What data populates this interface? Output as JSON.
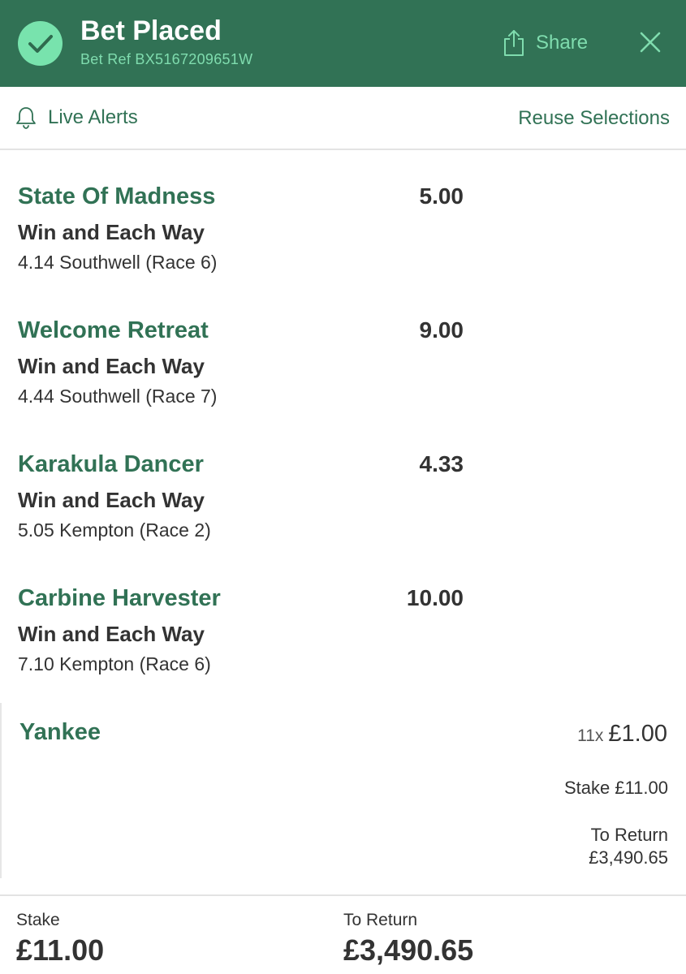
{
  "header": {
    "title": "Bet Placed",
    "bet_ref": "Bet Ref BX5167209651W",
    "share_label": "Share",
    "status_icon": "check-icon",
    "colors": {
      "background": "#317255",
      "accent": "#78e3ad"
    }
  },
  "alerts_bar": {
    "live_alerts_label": "Live Alerts",
    "reuse_label": "Reuse Selections"
  },
  "selections": [
    {
      "name": "State Of Madness",
      "odds": "5.00",
      "market": "Win and Each Way",
      "event": "4.14 Southwell (Race 6)"
    },
    {
      "name": "Welcome Retreat",
      "odds": "9.00",
      "market": "Win and Each Way",
      "event": "4.44 Southwell (Race 7)"
    },
    {
      "name": "Karakula Dancer",
      "odds": "4.33",
      "market": "Win and Each Way",
      "event": "5.05 Kempton (Race 2)"
    },
    {
      "name": "Carbine Harvester",
      "odds": "10.00",
      "market": "Win and Each Way",
      "event": "7.10 Kempton (Race 6)"
    }
  ],
  "bet_type": {
    "name": "Yankee",
    "multiplier": "11x",
    "unit_stake": "£1.00",
    "stake": "Stake £11.00",
    "to_return_label": "To Return",
    "to_return_value": "£3,490.65"
  },
  "footer": {
    "stake_label": "Stake",
    "stake_value": "£11.00",
    "return_label": "To Return",
    "return_value": "£3,490.65"
  }
}
